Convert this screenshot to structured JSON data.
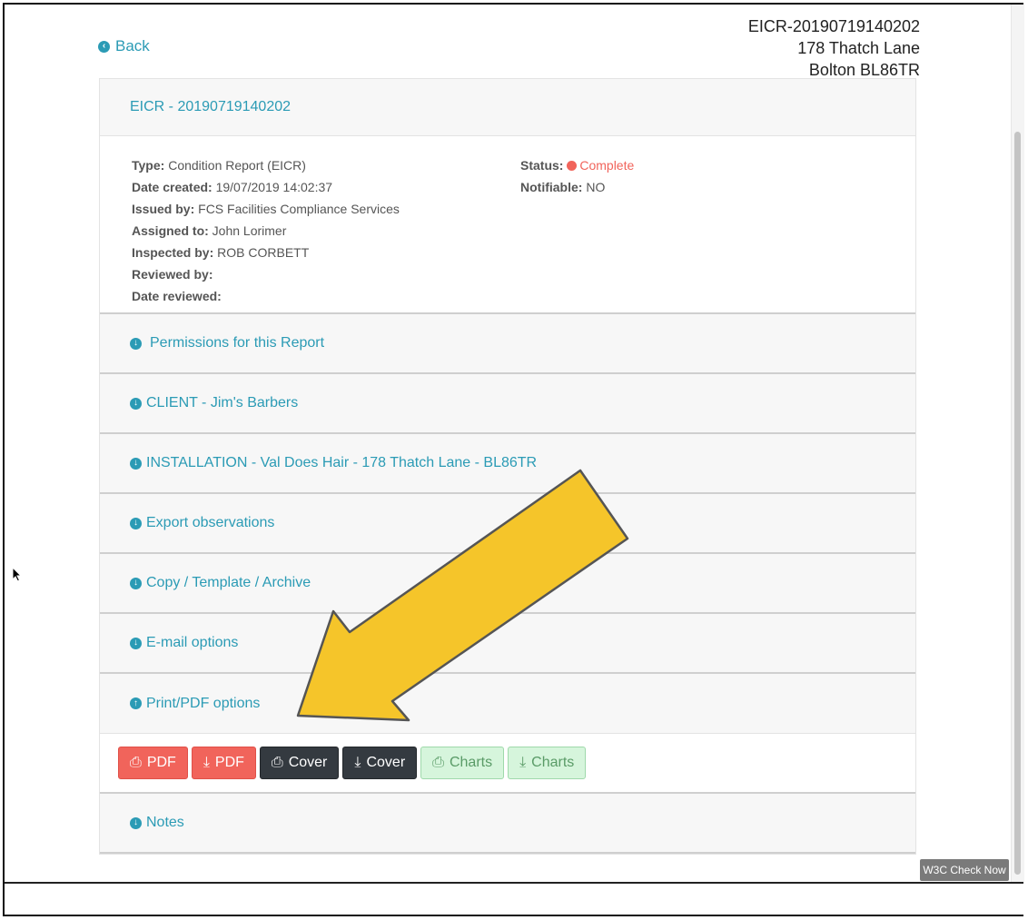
{
  "header": {
    "back_label": "Back",
    "address_lines": [
      "EICR-20190719140202",
      "178 Thatch Lane",
      "Bolton BL86TR"
    ]
  },
  "report": {
    "title": "EICR - 20190719140202",
    "details_left": [
      {
        "label": "Type:",
        "value": "Condition Report (EICR)"
      },
      {
        "label": "Date created:",
        "value": "19/07/2019 14:02:37"
      },
      {
        "label": "Issued by:",
        "value": "FCS Facilities Compliance Services"
      },
      {
        "label": "Assigned to:",
        "value": "John Lorimer"
      },
      {
        "label": "Inspected by:",
        "value": "ROB CORBETT"
      },
      {
        "label": "Reviewed by:",
        "value": ""
      },
      {
        "label": "Date reviewed:",
        "value": ""
      }
    ],
    "details_right": {
      "status_label": "Status:",
      "status_value": "Complete",
      "notifiable_label": "Notifiable:",
      "notifiable_value": "NO"
    },
    "sections": {
      "permissions": "Permissions for this Report",
      "client": "CLIENT - Jim's Barbers",
      "installation": "INSTALLATION - Val Does Hair - 178 Thatch Lane - BL86TR",
      "export": "Export observations",
      "copy": "Copy / Template / Archive",
      "email": "E-mail options",
      "print": "Print/PDF options",
      "notes": "Notes"
    },
    "print_buttons": [
      {
        "label": "PDF",
        "icon": "print-icon",
        "style": "red"
      },
      {
        "label": "PDF",
        "icon": "download-icon",
        "style": "red"
      },
      {
        "label": "Cover",
        "icon": "print-icon",
        "style": "dark"
      },
      {
        "label": "Cover",
        "icon": "download-icon",
        "style": "dark"
      },
      {
        "label": "Charts",
        "icon": "print-icon",
        "style": "green"
      },
      {
        "label": "Charts",
        "icon": "download-icon",
        "style": "green"
      }
    ]
  },
  "w3c_label": "W3C Check Now",
  "colors": {
    "link": "#2b9bb5",
    "status_complete": "#f1645b",
    "annotation_arrow": "#f5c52a"
  }
}
